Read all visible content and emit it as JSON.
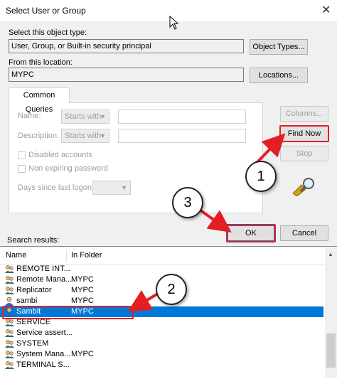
{
  "window": {
    "title": "Select User or Group",
    "close_glyph": "✕"
  },
  "object_type": {
    "label": "Select this object type:",
    "value": "User, Group, or Built-in security principal",
    "button": "Object Types..."
  },
  "location": {
    "label": "From this location:",
    "value": "MYPC",
    "button": "Locations..."
  },
  "queries": {
    "tab": "Common Queries",
    "name_label": "Name:",
    "name_mode": "Starts with",
    "description_label": "Description:",
    "description_mode": "Starts with",
    "disabled_accounts": "Disabled accounts",
    "non_expiring": "Non expiring password",
    "days_label": "Days since last logon:"
  },
  "side_buttons": {
    "columns": "Columns...",
    "find_now": "Find Now",
    "stop": "Stop"
  },
  "dialog_buttons": {
    "ok": "OK",
    "cancel": "Cancel"
  },
  "results": {
    "label": "Search results:",
    "columns": [
      "Name",
      "In Folder"
    ],
    "rows": [
      {
        "name": "REMOTE INT...",
        "folder": "",
        "icon": "group-icon"
      },
      {
        "name": "Remote Mana...",
        "folder": "MYPC",
        "icon": "group-icon"
      },
      {
        "name": "Replicator",
        "folder": "MYPC",
        "icon": "group-icon"
      },
      {
        "name": "sambi",
        "folder": "MYPC",
        "icon": "user-icon"
      },
      {
        "name": "Sambit",
        "folder": "MYPC",
        "icon": "user-icon",
        "selected": true
      },
      {
        "name": "SERVICE",
        "folder": "",
        "icon": "group-icon"
      },
      {
        "name": "Service assert...",
        "folder": "",
        "icon": "group-icon"
      },
      {
        "name": "SYSTEM",
        "folder": "",
        "icon": "group-icon"
      },
      {
        "name": "System Mana...",
        "folder": "MYPC",
        "icon": "group-icon"
      },
      {
        "name": "TERMINAL S...",
        "folder": "",
        "icon": "group-icon"
      }
    ]
  },
  "annotations": [
    {
      "number": "1",
      "target": "find-now-button"
    },
    {
      "number": "2",
      "target": "result-row-sambit"
    },
    {
      "number": "3",
      "target": "ok-button"
    }
  ],
  "colors": {
    "accent": "#0078d7",
    "annotation_red": "#e31e24",
    "selection": "#0078d7"
  }
}
